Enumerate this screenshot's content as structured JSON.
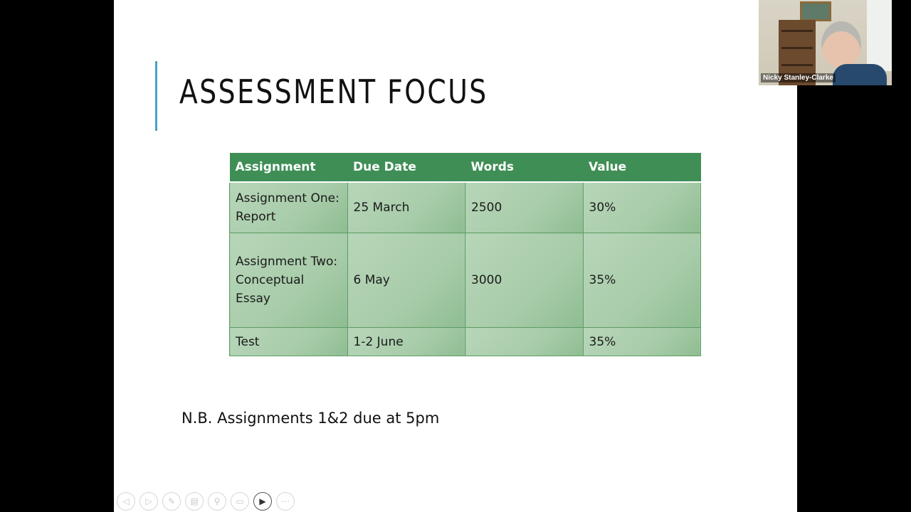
{
  "slide": {
    "title": "ASSESSMENT FOCUS",
    "table": {
      "headers": [
        "Assignment",
        "Due Date",
        "Words",
        "Value"
      ],
      "rows": [
        [
          "Assignment One: Report",
          "25 March",
          "2500",
          "30%"
        ],
        [
          "Assignment Two: Conceptual Essay",
          "6 May",
          "3000",
          "35%"
        ],
        [
          "Test",
          "1-2 June",
          "",
          "35%"
        ]
      ]
    },
    "note": "N.B. Assignments 1&2 due at 5pm"
  },
  "participant": {
    "name": "Nicky Stanley-Clarke"
  },
  "controls": [
    {
      "icon": "previous-icon",
      "glyph": "◁"
    },
    {
      "icon": "next-icon",
      "glyph": "▷"
    },
    {
      "icon": "pen-icon",
      "glyph": "✎"
    },
    {
      "icon": "slides-icon",
      "glyph": "▤"
    },
    {
      "icon": "zoom-icon",
      "glyph": "⚲"
    },
    {
      "icon": "subtitles-icon",
      "glyph": "▭"
    },
    {
      "icon": "camera-icon",
      "glyph": "▶"
    },
    {
      "icon": "more-icon",
      "glyph": "⋯"
    }
  ],
  "colors": {
    "header_green": "#3e8e56",
    "cell_green": "#b7d6b9",
    "accent_bar": "#4aa3c4"
  }
}
